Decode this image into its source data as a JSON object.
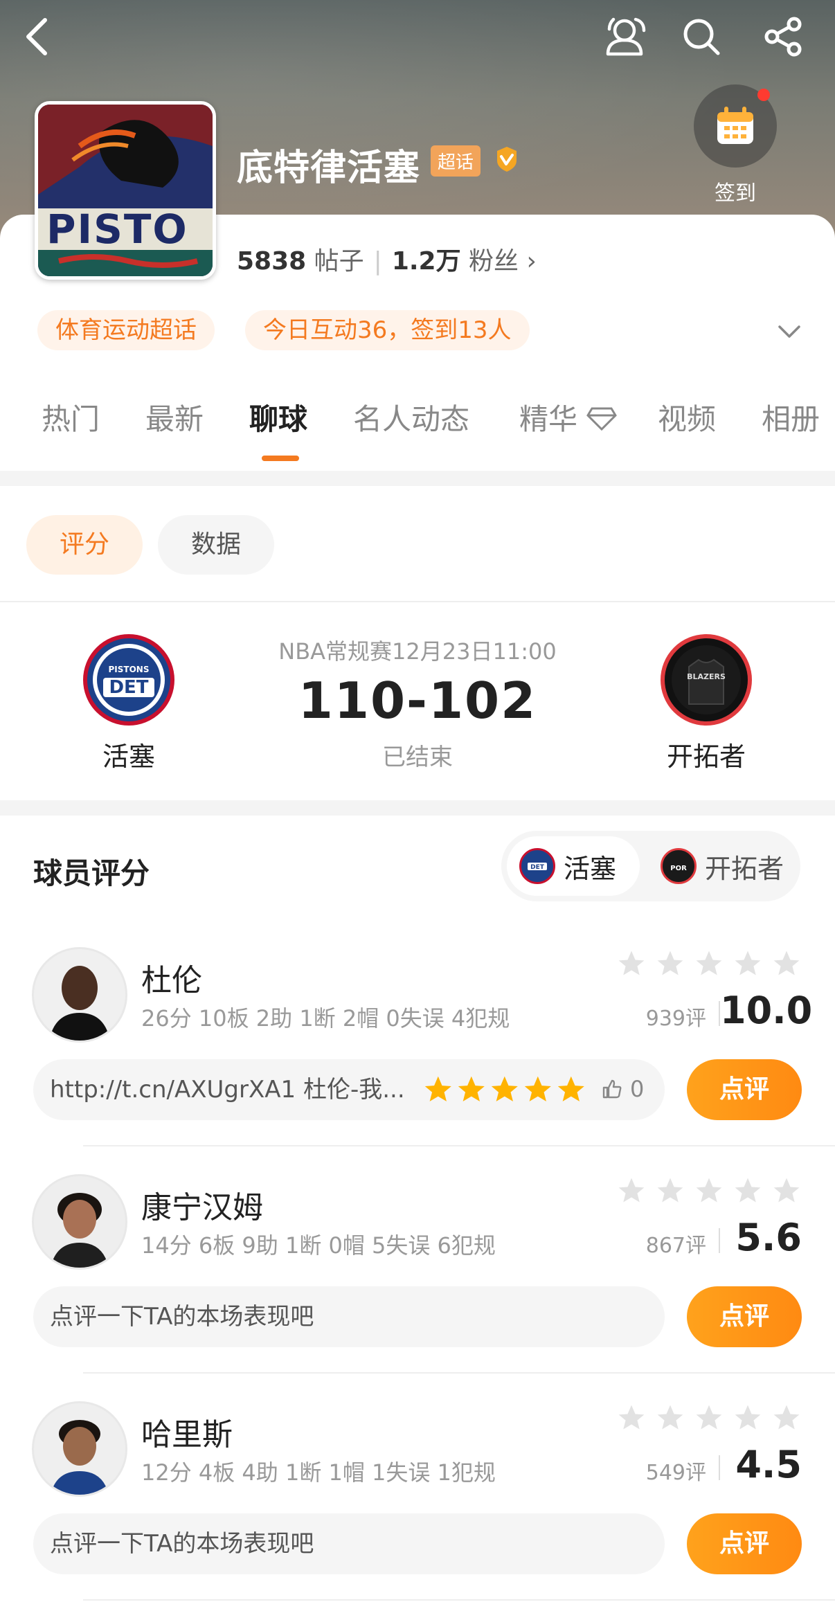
{
  "header": {
    "team_name": "底特律活塞",
    "super_badge": "超话",
    "checkin_label": "签到",
    "logo_text": "PISTO"
  },
  "stats": {
    "posts_count": "5838",
    "posts_label": "帖子",
    "fans_count": "1.2万",
    "fans_label": "粉丝"
  },
  "pills": {
    "category": "体育运动超话",
    "activity": "今日互动36，签到13人"
  },
  "tabs": [
    {
      "label": "热门"
    },
    {
      "label": "最新"
    },
    {
      "label": "聊球"
    },
    {
      "label": "名人动态"
    },
    {
      "label": "精华"
    },
    {
      "label": "视频"
    },
    {
      "label": "相册"
    }
  ],
  "subtabs": {
    "rating": "评分",
    "data": "数据"
  },
  "match": {
    "meta": "NBA常规赛12月23日11:00",
    "score": "110-102",
    "status": "已结束",
    "home": {
      "name": "活塞",
      "abbr": "DET",
      "subtext": "PISTONS",
      "color": "#1d428a"
    },
    "away": {
      "name": "开拓者",
      "abbr": "POR",
      "subtext": "BLAZERS",
      "color": "#e03a3e"
    }
  },
  "ratings": {
    "title": "球员评分",
    "toggle_home": "活塞",
    "toggle_away": "开拓者"
  },
  "players": [
    {
      "name": "杜伦",
      "stats": "26分 10板 2助 1断 2帽 0失误 4犯规",
      "count": "939评",
      "score": "10.0",
      "comment": "http://t.cn/AXUgrXA1 杜伦-我...",
      "comment_rating": 5,
      "likes": "0",
      "button": "点评"
    },
    {
      "name": "康宁汉姆",
      "stats": "14分 6板 9助 1断 0帽 5失误 6犯规",
      "count": "867评",
      "score": "5.6",
      "comment": "点评一下TA的本场表现吧",
      "button": "点评"
    },
    {
      "name": "哈里斯",
      "stats": "12分 4板 4助 1断 1帽 1失误 1犯规",
      "count": "549评",
      "score": "4.5",
      "comment": "点评一下TA的本场表现吧",
      "button": "点评"
    }
  ],
  "colors": {
    "accent": "#f47a20",
    "star_gold": "#ffb300",
    "star_gray": "#e2e2e2",
    "button": "#ff9a1a"
  }
}
